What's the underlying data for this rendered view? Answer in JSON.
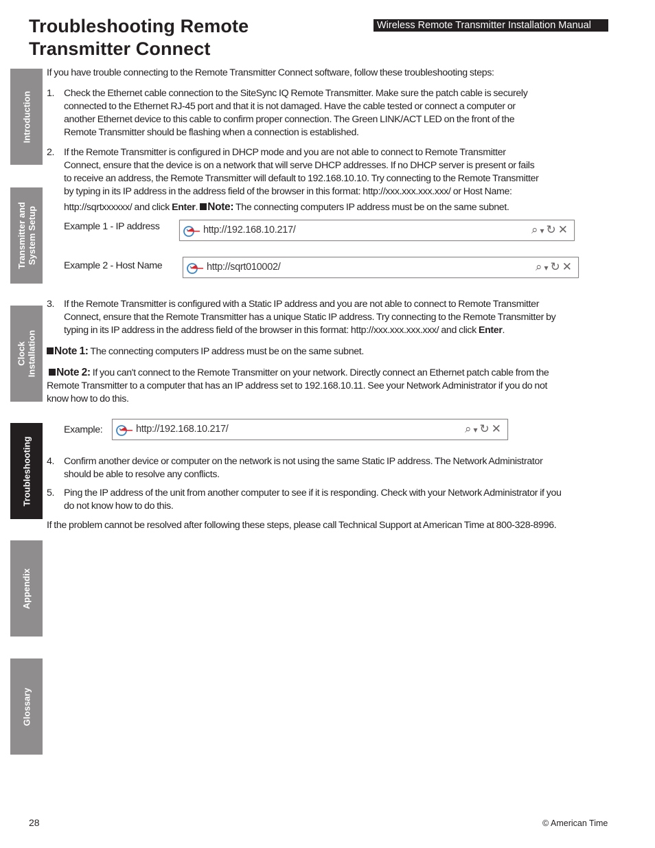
{
  "page": {
    "title_line1": "Troubleshooting Remote",
    "title_line2": "Transmitter Connect",
    "header_band": "Wireless Remote Transmitter Installation Manual",
    "page_number": "28",
    "copyright": "© American Time"
  },
  "tabs": [
    {
      "label": "Introduction",
      "active": false
    },
    {
      "label": "Transmitter and System Setup",
      "line1": "Transmitter and",
      "line2": "System Setup",
      "active": false
    },
    {
      "label": "Clock Installation",
      "line1": "Clock",
      "line2": "Installation",
      "active": false
    },
    {
      "label": "Troubleshooting",
      "active": true
    },
    {
      "label": "Appendix",
      "active": false
    },
    {
      "label": "Glossary",
      "active": false
    }
  ],
  "intro": "If you have trouble connecting to the Remote Transmitter Connect software, follow these troubleshooting steps:",
  "steps": [
    {
      "num": "1.",
      "lines": [
        "Check the Ethernet cable connection to the SiteSync IQ Remote Transmitter. Make sure the patch cable is securely",
        "connected to the Ethernet RJ-45 port and that it is not damaged. Have the cable tested or connect a computer or",
        "another Ethernet device to this cable to confirm proper connection. The Green LINK/ACT LED on the front of the",
        "Remote Transmitter should be flashing when a connection is established."
      ]
    },
    {
      "num": "2.",
      "lines": [
        "If the Remote Transmitter is configured in DHCP mode and you are not able to connect to Remote Transmitter",
        "Connect, ensure that the device is on a network that will serve DHCP addresses. If no DHCP server is present or fails",
        "to receive an address, the Remote Transmitter will default to 192.168.10.10. Try connecting to the Remote Transmitter",
        "by typing in its IP address in the address field of the browser in this format: http://xxx.xxx.xxx.xxx/ or Host Name:"
      ],
      "last_pre": "http://sqrtxxxxxx/ and click ",
      "last_bold": "Enter",
      "last_mid": ". ",
      "note_label": "Note:",
      "note_text": " The connecting computers IP address must be on the same subnet."
    },
    {
      "num": "3.",
      "lines": [
        "If the Remote Transmitter is configured with a Static IP address and you are not able to connect to Remote Transmitter",
        "Connect, ensure that the Remote Transmitter has a unique Static IP address. Try connecting to the Remote Transmitter by"
      ],
      "last_pre": "typing in its IP address in the address field of the browser in this format: http://xxx.xxx.xxx.xxx/ and click ",
      "last_bold": "Enter",
      "last_mid": "."
    },
    {
      "num": "4.",
      "lines": [
        "Confirm another device or computer on the network is not using the same Static IP address. The Network Administrator",
        "should be able to resolve any conflicts."
      ]
    },
    {
      "num": "5.",
      "lines": [
        "Ping the IP address of the unit from another computer to see if it is responding. Check with your Network Administrator if you",
        "do not know how to do this."
      ]
    }
  ],
  "examples": [
    {
      "label": "Example 1 - IP address",
      "url": "http://192.168.10.217/"
    },
    {
      "label": "Example 2 - Host Name",
      "url": "http://sqrt010002/"
    },
    {
      "label": "Example:",
      "url": "http://192.168.10.217/"
    }
  ],
  "browser_controls": {
    "search_icon": "⌕",
    "dropdown_icon": "▾",
    "refresh_icon": "↻",
    "close_icon": "✕"
  },
  "notes": {
    "note1_label": "Note 1:",
    "note1_text": " The connecting computers IP address must be on the same subnet.",
    "note2_label": "Note 2:",
    "note2_text_line1": " If you can't connect to the Remote Transmitter on your network. Directly connect an Ethernet patch cable from the",
    "note2_text_line2": "Remote Transmitter to a computer that has an IP address set to 192.168.10.11. See your Network Administrator if you do not",
    "note2_text_line3": "know how to do this."
  },
  "closing": "If the problem cannot be resolved after following these steps, please call Technical Support at American Time at 800-328-8996.",
  "colors": {
    "tab_inactive": "#8f8d8e",
    "tab_active": "#231f20",
    "text": "#231f20",
    "logo_blue": "#3a86c8",
    "logo_red": "#e0252b"
  }
}
